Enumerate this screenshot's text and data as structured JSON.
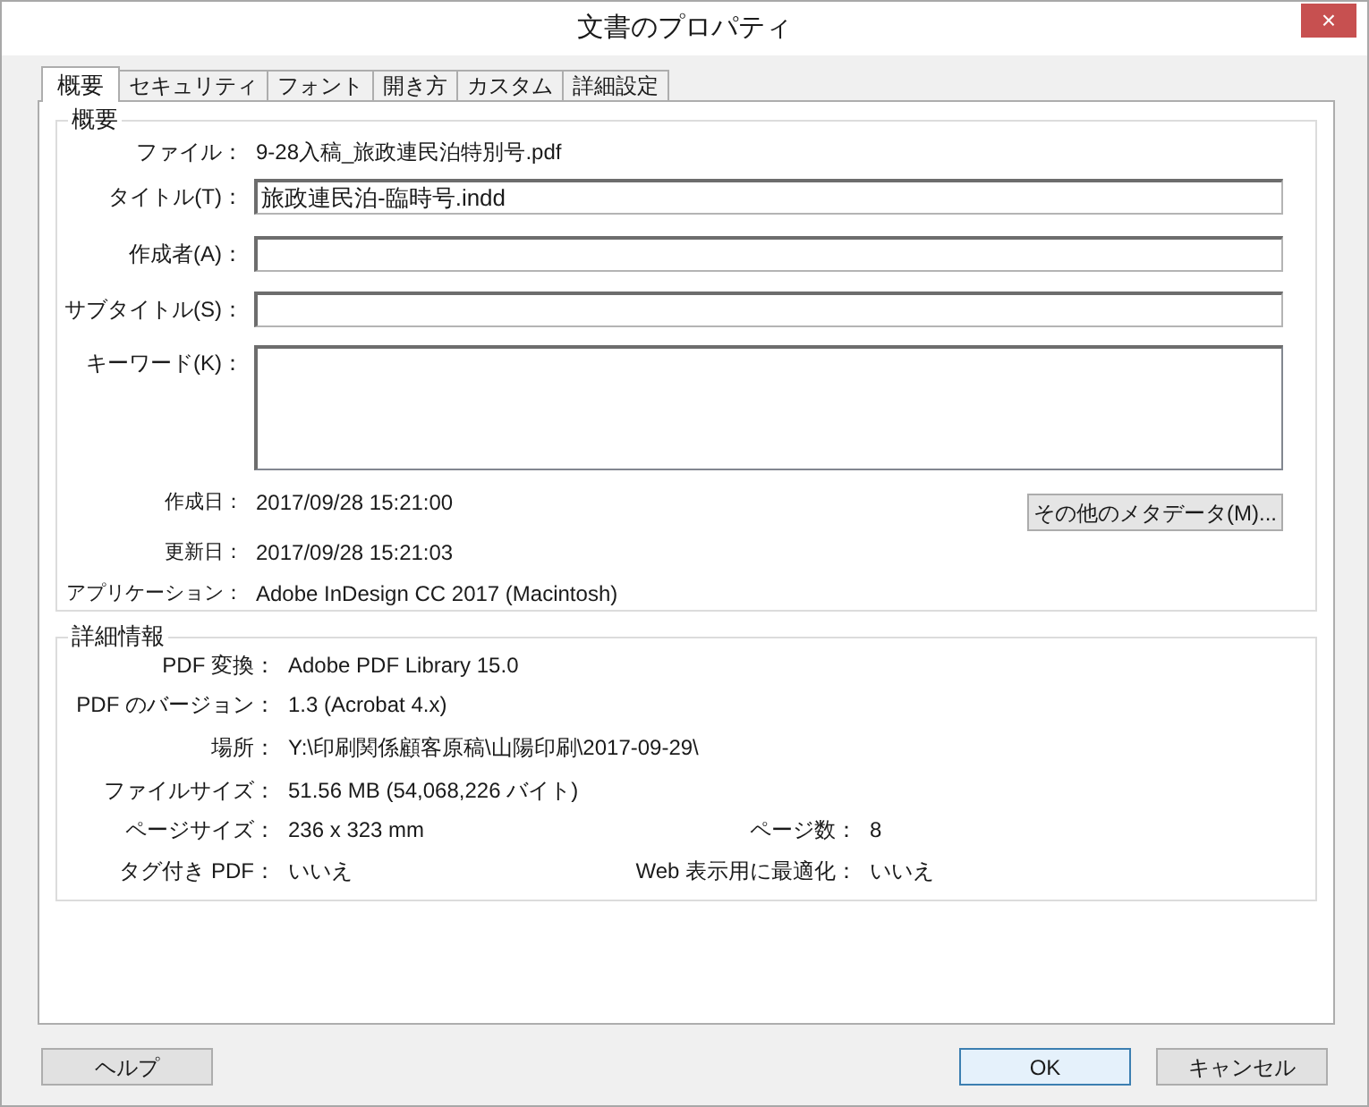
{
  "window": {
    "title": "文書のプロパティ",
    "close": "×"
  },
  "tabs": [
    {
      "label": "概要",
      "selected": true
    },
    {
      "label": "セキュリティ",
      "selected": false
    },
    {
      "label": "フォント",
      "selected": false
    },
    {
      "label": "開き方",
      "selected": false
    },
    {
      "label": "カスタム",
      "selected": false
    },
    {
      "label": "詳細設定",
      "selected": false
    }
  ],
  "summary": {
    "title": "概要",
    "file": {
      "label": "ファイル：",
      "value": "9-28入稿_旅政連民泊特別号.pdf"
    },
    "fields": [
      {
        "label": "タイトル(T)：",
        "value": "旅政連民泊-臨時号.indd",
        "kind": "line"
      },
      {
        "label": "作成者(A)：",
        "kind": "line"
      },
      {
        "label": "サブタイトル(S)：",
        "kind": "line"
      },
      {
        "label": "キーワード(K)：",
        "kind": "multiline"
      }
    ],
    "info": [
      {
        "label": "作成日：",
        "value": "2017/09/28 15:21:00"
      },
      {
        "label": "更新日：",
        "value": "2017/09/28 15:21:03"
      },
      {
        "label": "アプリケーション：",
        "value": "Adobe InDesign CC 2017 (Macintosh)"
      }
    ],
    "more_button": "その他のメタデータ(M)..."
  },
  "details": {
    "title": "詳細情報",
    "rows": [
      {
        "cells": [
          {
            "label": "PDF 変換：",
            "value": "Adobe PDF Library 15.0"
          }
        ]
      },
      {
        "cells": [
          {
            "label": "PDF のバージョン：",
            "value": "1.3 (Acrobat 4.x)"
          }
        ]
      },
      {
        "cells": [
          {
            "label": "場所：",
            "value": "Y:\\印刷関係顧客原稿\\山陽印刷\\2017-09-29\\"
          }
        ]
      },
      {
        "cells": [
          {
            "label": "ファイルサイズ：",
            "value": "51.56 MB (54,068,226 バイト)"
          }
        ]
      },
      {
        "cells": [
          {
            "label": "ページサイズ：",
            "value": "236 x 323 mm"
          },
          {
            "label": "ページ数：",
            "value": "8"
          }
        ]
      },
      {
        "cells": [
          {
            "label": "タグ付き PDF：",
            "value": "いいえ"
          },
          {
            "label": "Web 表示用に最適化：",
            "value": "いいえ"
          }
        ]
      }
    ]
  },
  "buttons": [
    {
      "label": "ヘルプ",
      "default": false
    },
    {
      "label": "OK",
      "default": true
    },
    {
      "label": "キャンセル",
      "default": false
    }
  ]
}
